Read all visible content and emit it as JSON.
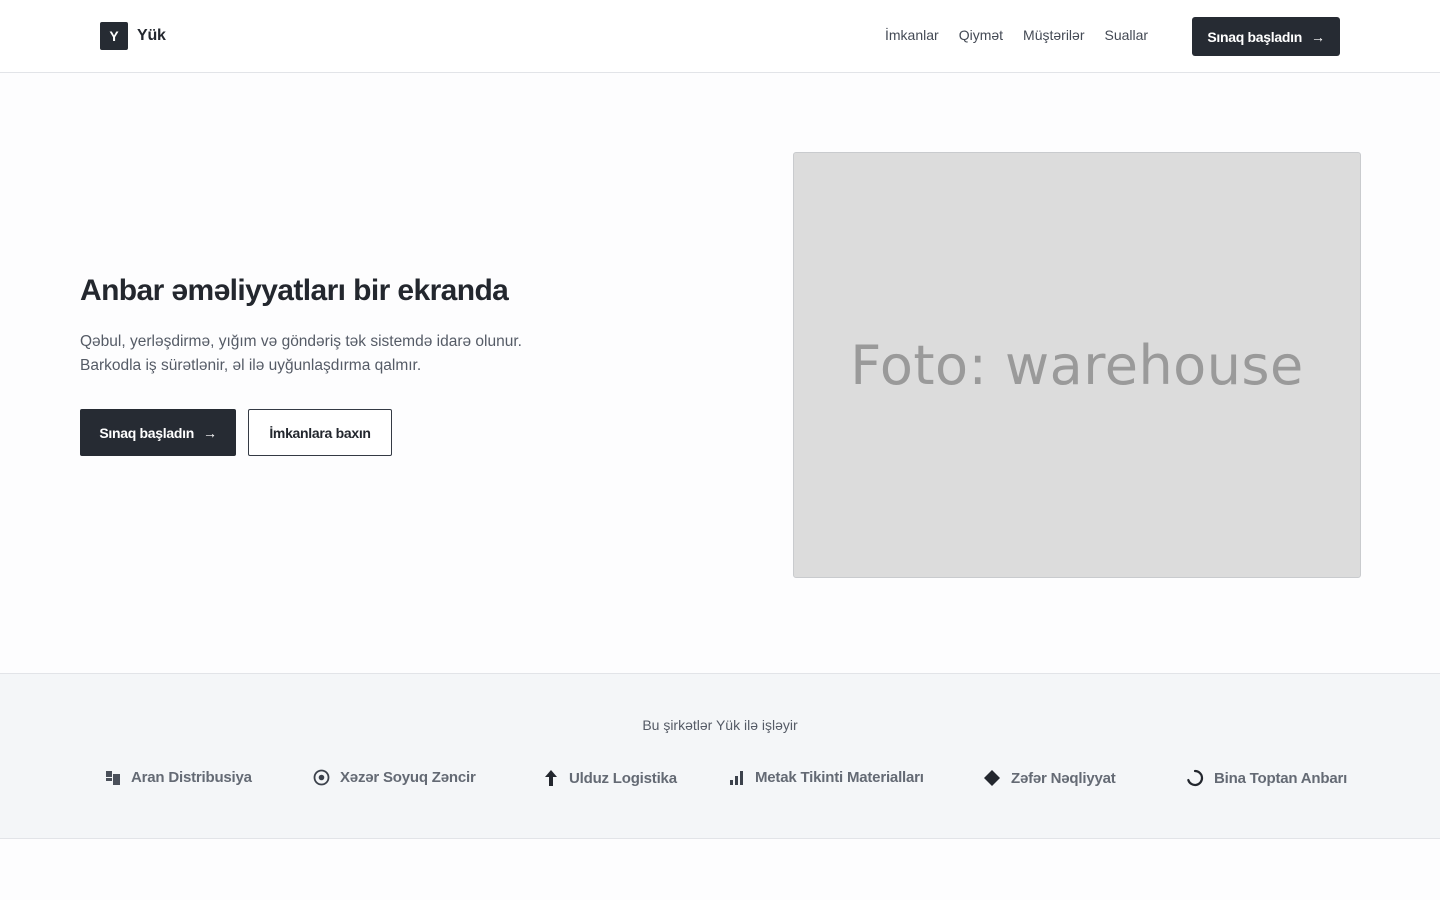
{
  "header": {
    "brand_mark": "Y",
    "brand_name": "Yük",
    "nav": [
      "İmkanlar",
      "Qiymət",
      "Müştərilər",
      "Suallar"
    ],
    "cta_label": "Sınaq başladın",
    "cta_icon": "arrow-right-icon"
  },
  "hero": {
    "title": "Anbar əməliyyatları bir ekranda",
    "subtitle_line1": "Qəbul, yerləşdirmə, yığım və göndəriş tək sistemdə idarə olunur.",
    "subtitle_line2": "Barkodla iş sürətlənir, əl ilə uyğunlaşdırma qalmır.",
    "primary_label": "Sınaq başladın",
    "secondary_label": "İmkanlara baxın",
    "photo_label": "Foto: warehouse"
  },
  "logos": {
    "title": "Bu şirkətlər Yük ilə işləyir",
    "items": [
      {
        "name": "Aran Distribusiya",
        "icon": "squares-icon"
      },
      {
        "name": "Xəzər Soyuq Zəncir",
        "icon": "target-icon"
      },
      {
        "name": "Ulduz Logistika",
        "icon": "arrow-up-icon"
      },
      {
        "name": "Metak Tikinti Materialları",
        "icon": "bar-chart-icon"
      },
      {
        "name": "Zəfər Nəqliyyat",
        "icon": "diamond-icon"
      },
      {
        "name": "Bina Toptan Anbarı",
        "icon": "spinner-icon"
      }
    ]
  },
  "colors": {
    "primary": "#262b33",
    "band_bg": "#f4f6f8",
    "photo_bg": "#dcdcdc"
  }
}
